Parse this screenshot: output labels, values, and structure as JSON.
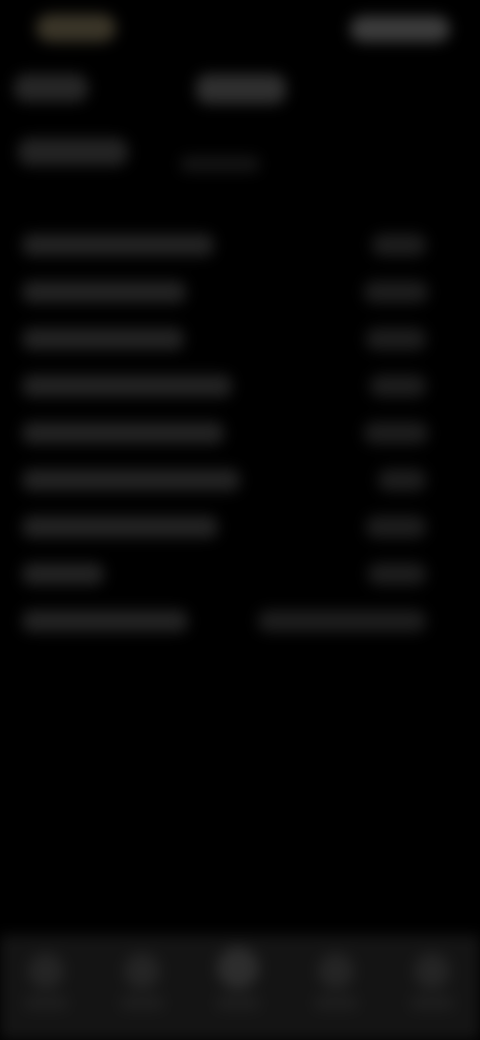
{
  "status_bar": {
    "time": "",
    "icons": [
      "signal-icon",
      "wifi-icon",
      "battery-icon"
    ]
  },
  "header": {
    "back_label": "",
    "title": ""
  },
  "section": {
    "title": "",
    "subtitle": ""
  },
  "rows": [
    {
      "label": "",
      "value": ""
    },
    {
      "label": "",
      "value": ""
    },
    {
      "label": "",
      "value": ""
    },
    {
      "label": "",
      "value": ""
    },
    {
      "label": "",
      "value": ""
    },
    {
      "label": "",
      "value": ""
    },
    {
      "label": "",
      "value": ""
    },
    {
      "label": "",
      "value": ""
    },
    {
      "label": "",
      "value": ""
    }
  ],
  "tab_bar": {
    "tabs": [
      {
        "icon": "home-icon",
        "label": ""
      },
      {
        "icon": "list-icon",
        "label": ""
      },
      {
        "icon": "center-icon",
        "label": ""
      },
      {
        "icon": "chart-icon",
        "label": ""
      },
      {
        "icon": "profile-icon",
        "label": ""
      }
    ],
    "active_index": 2
  },
  "colors": {
    "background": "#000000",
    "tab_bar_background": "#141414"
  }
}
